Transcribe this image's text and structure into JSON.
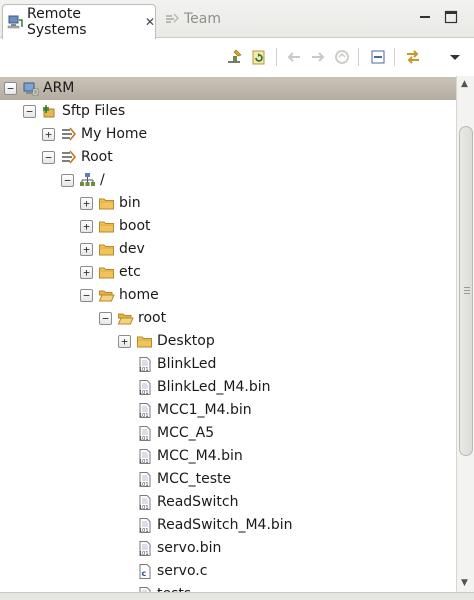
{
  "tabs": {
    "active": "Remote Systems",
    "active_close": "✕",
    "inactive": "Team"
  },
  "window_controls": {
    "minimize": "—",
    "maximize": "☐"
  },
  "toolbar": {
    "icons": [
      "new-connection-icon",
      "refresh-icon",
      "back-icon",
      "forward-icon",
      "home-icon",
      "collapse-all-icon",
      "link-with-editor-icon",
      "view-menu-icon"
    ]
  },
  "tree": {
    "top_fragment": "''",
    "rows": [
      {
        "label": "ARM",
        "expander": "−",
        "icon": "host-icon",
        "selected": true
      },
      {
        "label": "Sftp Files",
        "expander": "−",
        "icon": "sftp-files-icon"
      },
      {
        "label": "My Home",
        "expander": "+",
        "icon": "filter-icon"
      },
      {
        "label": "Root",
        "expander": "−",
        "icon": "filter-icon"
      },
      {
        "label": "/",
        "expander": "−",
        "icon": "root-drive-icon"
      },
      {
        "label": "bin",
        "expander": "+",
        "icon": "folder-icon"
      },
      {
        "label": "boot",
        "expander": "+",
        "icon": "folder-icon"
      },
      {
        "label": "dev",
        "expander": "+",
        "icon": "folder-icon"
      },
      {
        "label": "etc",
        "expander": "+",
        "icon": "folder-icon"
      },
      {
        "label": "home",
        "expander": "−",
        "icon": "open-folder-icon"
      },
      {
        "label": "root",
        "expander": "−",
        "icon": "open-folder-icon"
      },
      {
        "label": "Desktop",
        "expander": "+",
        "icon": "folder-icon"
      },
      {
        "label": "BlinkLed",
        "expander": "",
        "icon": "binary-file-icon"
      },
      {
        "label": "BlinkLed_M4.bin",
        "expander": "",
        "icon": "binary-file-icon"
      },
      {
        "label": "MCC1_M4.bin",
        "expander": "",
        "icon": "binary-file-icon"
      },
      {
        "label": "MCC_A5",
        "expander": "",
        "icon": "binary-file-icon"
      },
      {
        "label": "MCC_M4.bin",
        "expander": "",
        "icon": "binary-file-icon"
      },
      {
        "label": "MCC_teste",
        "expander": "",
        "icon": "binary-file-icon"
      },
      {
        "label": "ReadSwitch",
        "expander": "",
        "icon": "binary-file-icon"
      },
      {
        "label": "ReadSwitch_M4.bin",
        "expander": "",
        "icon": "binary-file-icon"
      },
      {
        "label": "servo.bin",
        "expander": "",
        "icon": "binary-file-icon"
      },
      {
        "label": "servo.c",
        "expander": "",
        "icon": "c-source-file-icon"
      },
      {
        "label": "tests",
        "expander": "",
        "icon": "binary-file-icon"
      }
    ]
  },
  "colors": {
    "selection": "#bdb6aa",
    "folder": "#e9b64a",
    "tab_bar": "#ececea"
  }
}
